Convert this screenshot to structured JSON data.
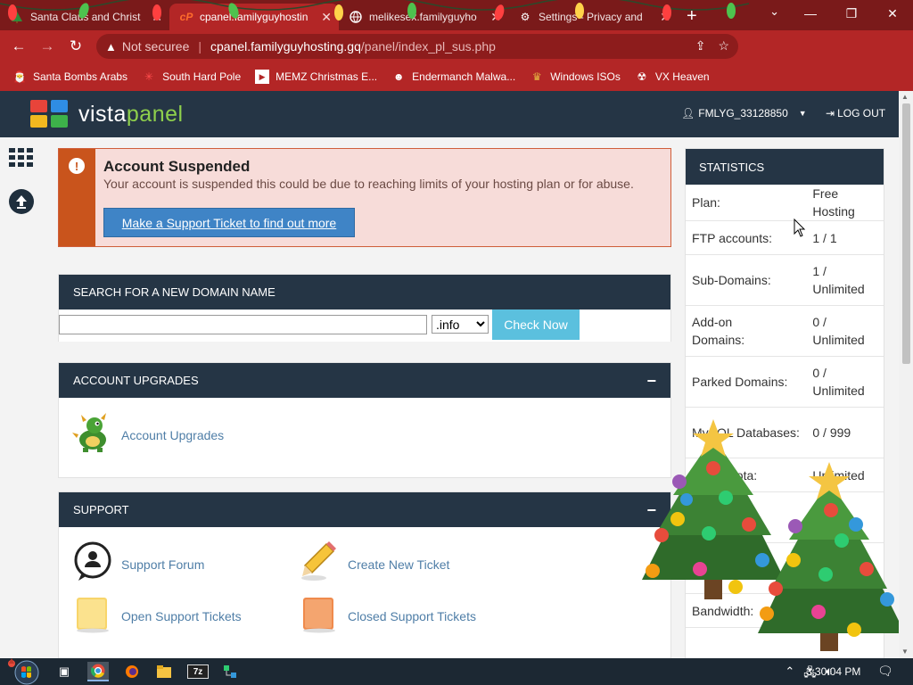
{
  "browser": {
    "tabs": [
      {
        "title": "Santa Claus and Christ",
        "icon": "tree-icon",
        "active": false
      },
      {
        "title": "cpanel.familyguyhostin",
        "icon": "cpanel-icon",
        "active": true
      },
      {
        "title": "melikesex.familyguyho",
        "icon": "globe-icon",
        "active": false
      },
      {
        "title": "Settings - Privacy and",
        "icon": "gear-icon",
        "active": false
      }
    ],
    "url": {
      "security_label": "Not securee",
      "host": "cpanel.familyguyhosting.gq",
      "path": "/panel/index_pl_sus.php"
    },
    "bookmarks": [
      {
        "label": "Santa Bombs Arabs",
        "icon": "santa-icon"
      },
      {
        "label": "South Hard Pole",
        "icon": "snowflake-icon"
      },
      {
        "label": "MEMZ Christmas E...",
        "icon": "video-icon"
      },
      {
        "label": "Endermanch Malwa...",
        "icon": "enderman-icon"
      },
      {
        "label": "Windows ISOs",
        "icon": "trophy-icon"
      },
      {
        "label": "VX Heaven",
        "icon": "vx-icon"
      }
    ],
    "accent_color": "#b32626"
  },
  "header": {
    "logo_text_part1": "vista",
    "logo_text_part2": "panel",
    "username": "FMLYG_33128850",
    "logout_label": "LOG OUT"
  },
  "alert": {
    "title": "Account Suspended",
    "message": "Your account is suspended this could be due to reaching limits of your hosting plan or for abuse.",
    "button_label": "Make a Support Ticket to find out more"
  },
  "domain_search": {
    "heading": "SEARCH FOR A NEW DOMAIN NAME",
    "input_value": "",
    "tld_selected": ".info",
    "button_label": "Check Now"
  },
  "upgrades": {
    "heading": "ACCOUNT UPGRADES",
    "items": [
      {
        "label": "Account Upgrades",
        "icon": "dragon-icon"
      }
    ]
  },
  "support": {
    "heading": "SUPPORT",
    "items": [
      {
        "label": "Support Forum",
        "icon": "chat-bubble-icon"
      },
      {
        "label": "Create New Ticket",
        "icon": "pencil-icon"
      },
      {
        "label": "Open Support Tickets",
        "icon": "yellow-folder-icon"
      },
      {
        "label": "Closed Support Tickets",
        "icon": "orange-folder-icon"
      }
    ]
  },
  "statistics": {
    "heading": "STATISTICS",
    "rows": [
      {
        "key": "Plan:",
        "value": "Free Hosting"
      },
      {
        "key": "FTP accounts:",
        "value": "1 / 1"
      },
      {
        "key": "Sub-Domains:",
        "value": "1 / Unlimited"
      },
      {
        "key": "Add-on Domains:",
        "value": "0 / Unlimited"
      },
      {
        "key": "Parked Domains:",
        "value": "0 / Unlimited"
      },
      {
        "key": "MySQL Databases:",
        "value": "0 / 999"
      },
      {
        "key": "Disk Quota:",
        "value": "Unlimited"
      },
      {
        "key": "",
        "value": ""
      },
      {
        "key": "",
        "value": ""
      },
      {
        "key": "Bandwidth:",
        "value": ""
      }
    ]
  },
  "taskbar": {
    "clock": "3:30:04 PM"
  }
}
